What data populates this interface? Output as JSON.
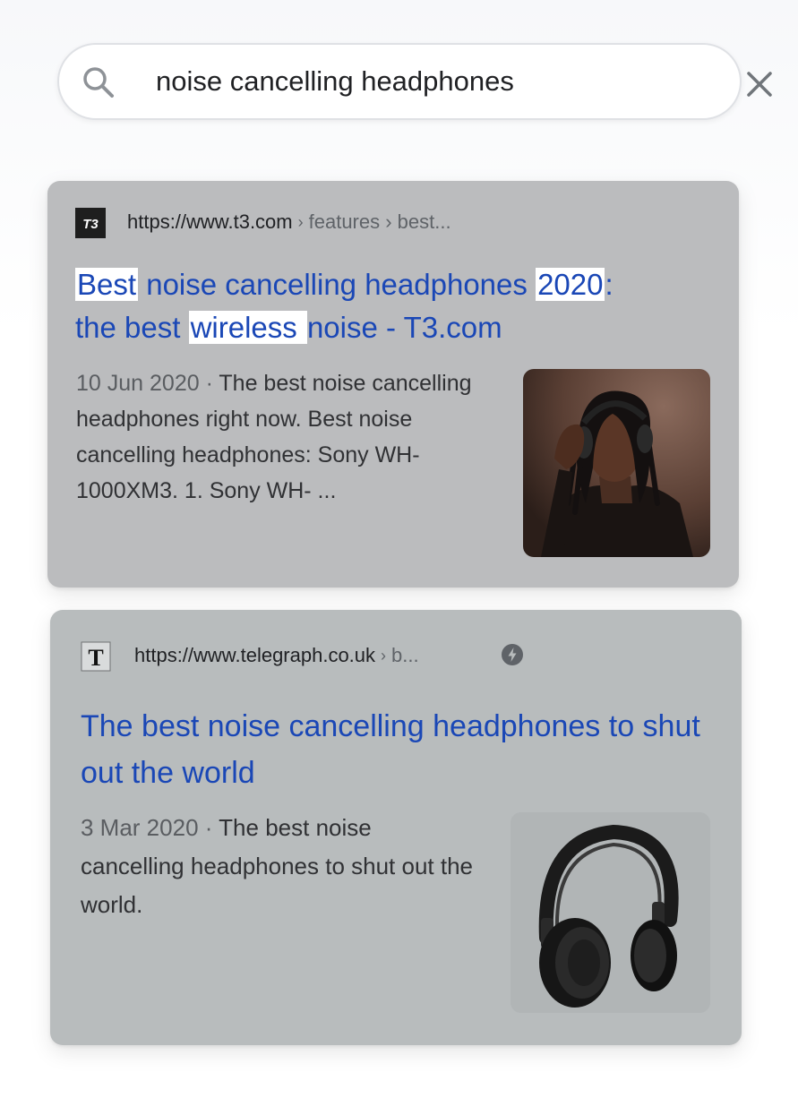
{
  "search": {
    "query": "noise cancelling headphones",
    "search_icon": "search-icon",
    "clear_icon": "close-icon"
  },
  "results": [
    {
      "favicon": "t3-logo",
      "url_host": "https://www.t3.com",
      "url_crumbs": "features › best...",
      "title_parts": {
        "p1": "Best",
        "p2": " noise cancelling headphones ",
        "p3": "2020",
        "p4": ":",
        "p5": "the best ",
        "p6": "wireless ",
        "p7": "noise - T3.com"
      },
      "date": "10 Jun 2020",
      "separator": " · ",
      "snippet": "The best noise cancelling headphones right now. Best noise cancelling headphones: Sony WH-1000XM3. 1. Sony WH- ...",
      "thumbnail": "man-wearing-headphones-image"
    },
    {
      "favicon": "telegraph-logo",
      "url_host": "https://www.telegraph.co.uk",
      "url_crumbs": "b...",
      "amp_icon": "amp-lightning-icon",
      "title": "The best noise cancelling headphones to shut out the world",
      "date": "3 Mar 2020",
      "separator": " · ",
      "snippet": "The best noise cancelling headphones to shut out the world.",
      "thumbnail": "headphones-product-image"
    }
  ],
  "colors": {
    "link": "#1a47b6",
    "highlight": "#ffffff",
    "card1_bg": "#bbbcbe",
    "card2_bg": "#b8bcbd"
  }
}
